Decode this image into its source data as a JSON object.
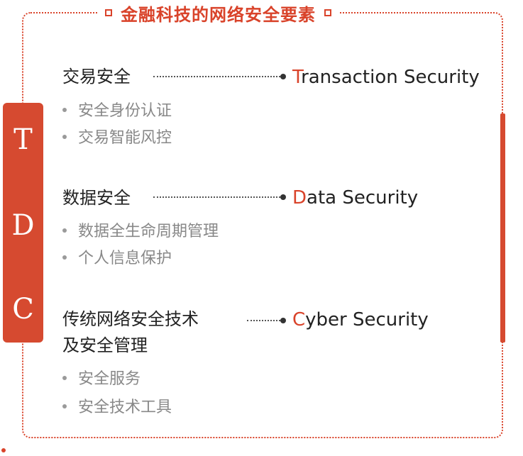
{
  "title": "金融科技的网络安全要素",
  "acronym": [
    "T",
    "D",
    "C"
  ],
  "sections": [
    {
      "title": "交易安全",
      "en_first": "T",
      "en_rest": "ransaction Security",
      "items": [
        "安全身份认证",
        "交易智能风控"
      ]
    },
    {
      "title": "数据安全",
      "en_first": "D",
      "en_rest": "ata Security",
      "items": [
        "数据全生命周期管理",
        "个人信息保护"
      ]
    },
    {
      "title_line1": "传统网络安全技术",
      "title_line2": "及安全管理",
      "en_first": "C",
      "en_rest": "yber Security",
      "items": [
        "安全服务",
        "安全技术工具"
      ]
    }
  ],
  "colors": {
    "accent": "#d9432a",
    "text": "#222222",
    "muted": "#888888"
  }
}
